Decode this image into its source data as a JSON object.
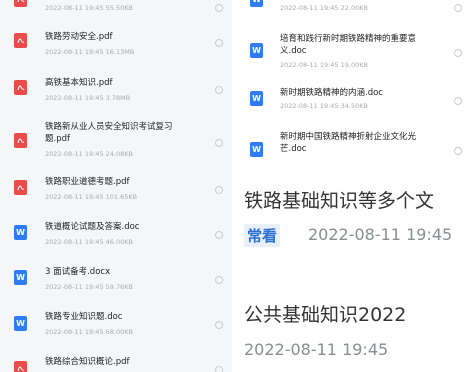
{
  "left_files": [
    {
      "name": "",
      "meta": "2022-08-11 19:45 55.50KB",
      "type": "pdf"
    },
    {
      "name": "铁路劳动安全.pdf",
      "meta": "2022-08-11 19:45 16.13MB",
      "type": "pdf"
    },
    {
      "name": "高铁基本知识.pdf",
      "meta": "2022-08-11 19:45 3.78MB",
      "type": "pdf"
    },
    {
      "name": "铁路新从业人员安全知识考试复习题.pdf",
      "meta": "2022-08-11 19:45 24.08KB",
      "type": "pdf"
    },
    {
      "name": "铁路职业道德考题.pdf",
      "meta": "2022-08-11 19:45 101.65KB",
      "type": "pdf"
    },
    {
      "name": "铁道概论试题及答案.doc",
      "meta": "2022-08-11 19:45 46.00KB",
      "type": "doc"
    },
    {
      "name": "3 面试备考.docx",
      "meta": "2022-08-11 19:45 59.76KB",
      "type": "doc"
    },
    {
      "name": "铁路专业知识题.doc",
      "meta": "2022-08-11 19:45 68.00KB",
      "type": "doc"
    },
    {
      "name": "铁路综合知识概论.pdf",
      "meta": "",
      "type": "pdf"
    }
  ],
  "right_files": [
    {
      "name": "",
      "meta": "2022-08-11 19:45 22.00KB",
      "type": "doc"
    },
    {
      "name": "培育和践行新时期铁路精神的重要意义.doc",
      "meta": "2022-08-11 19:45 19.00KB",
      "type": "doc"
    },
    {
      "name": "新时期铁路精神的内涵.doc",
      "meta": "2022-08-11 19:45 34.50KB",
      "type": "doc"
    },
    {
      "name": "新时期中国铁路精神折射企业文化光芒.doc",
      "meta": "",
      "type": "doc"
    }
  ],
  "article1": {
    "title": "铁路基础知识等多个文",
    "badge": "常看",
    "date": "2022-08-11  19:45"
  },
  "article2": {
    "title": "公共基础知识2022",
    "date": "2022-08-11  19:45"
  },
  "colors": {
    "pdf": "#ea4b4b",
    "doc": "#2f7cf6",
    "badge": "#2d6fd0"
  },
  "icons": {
    "pdf": "pdf-file-icon",
    "doc": "word-file-icon"
  }
}
